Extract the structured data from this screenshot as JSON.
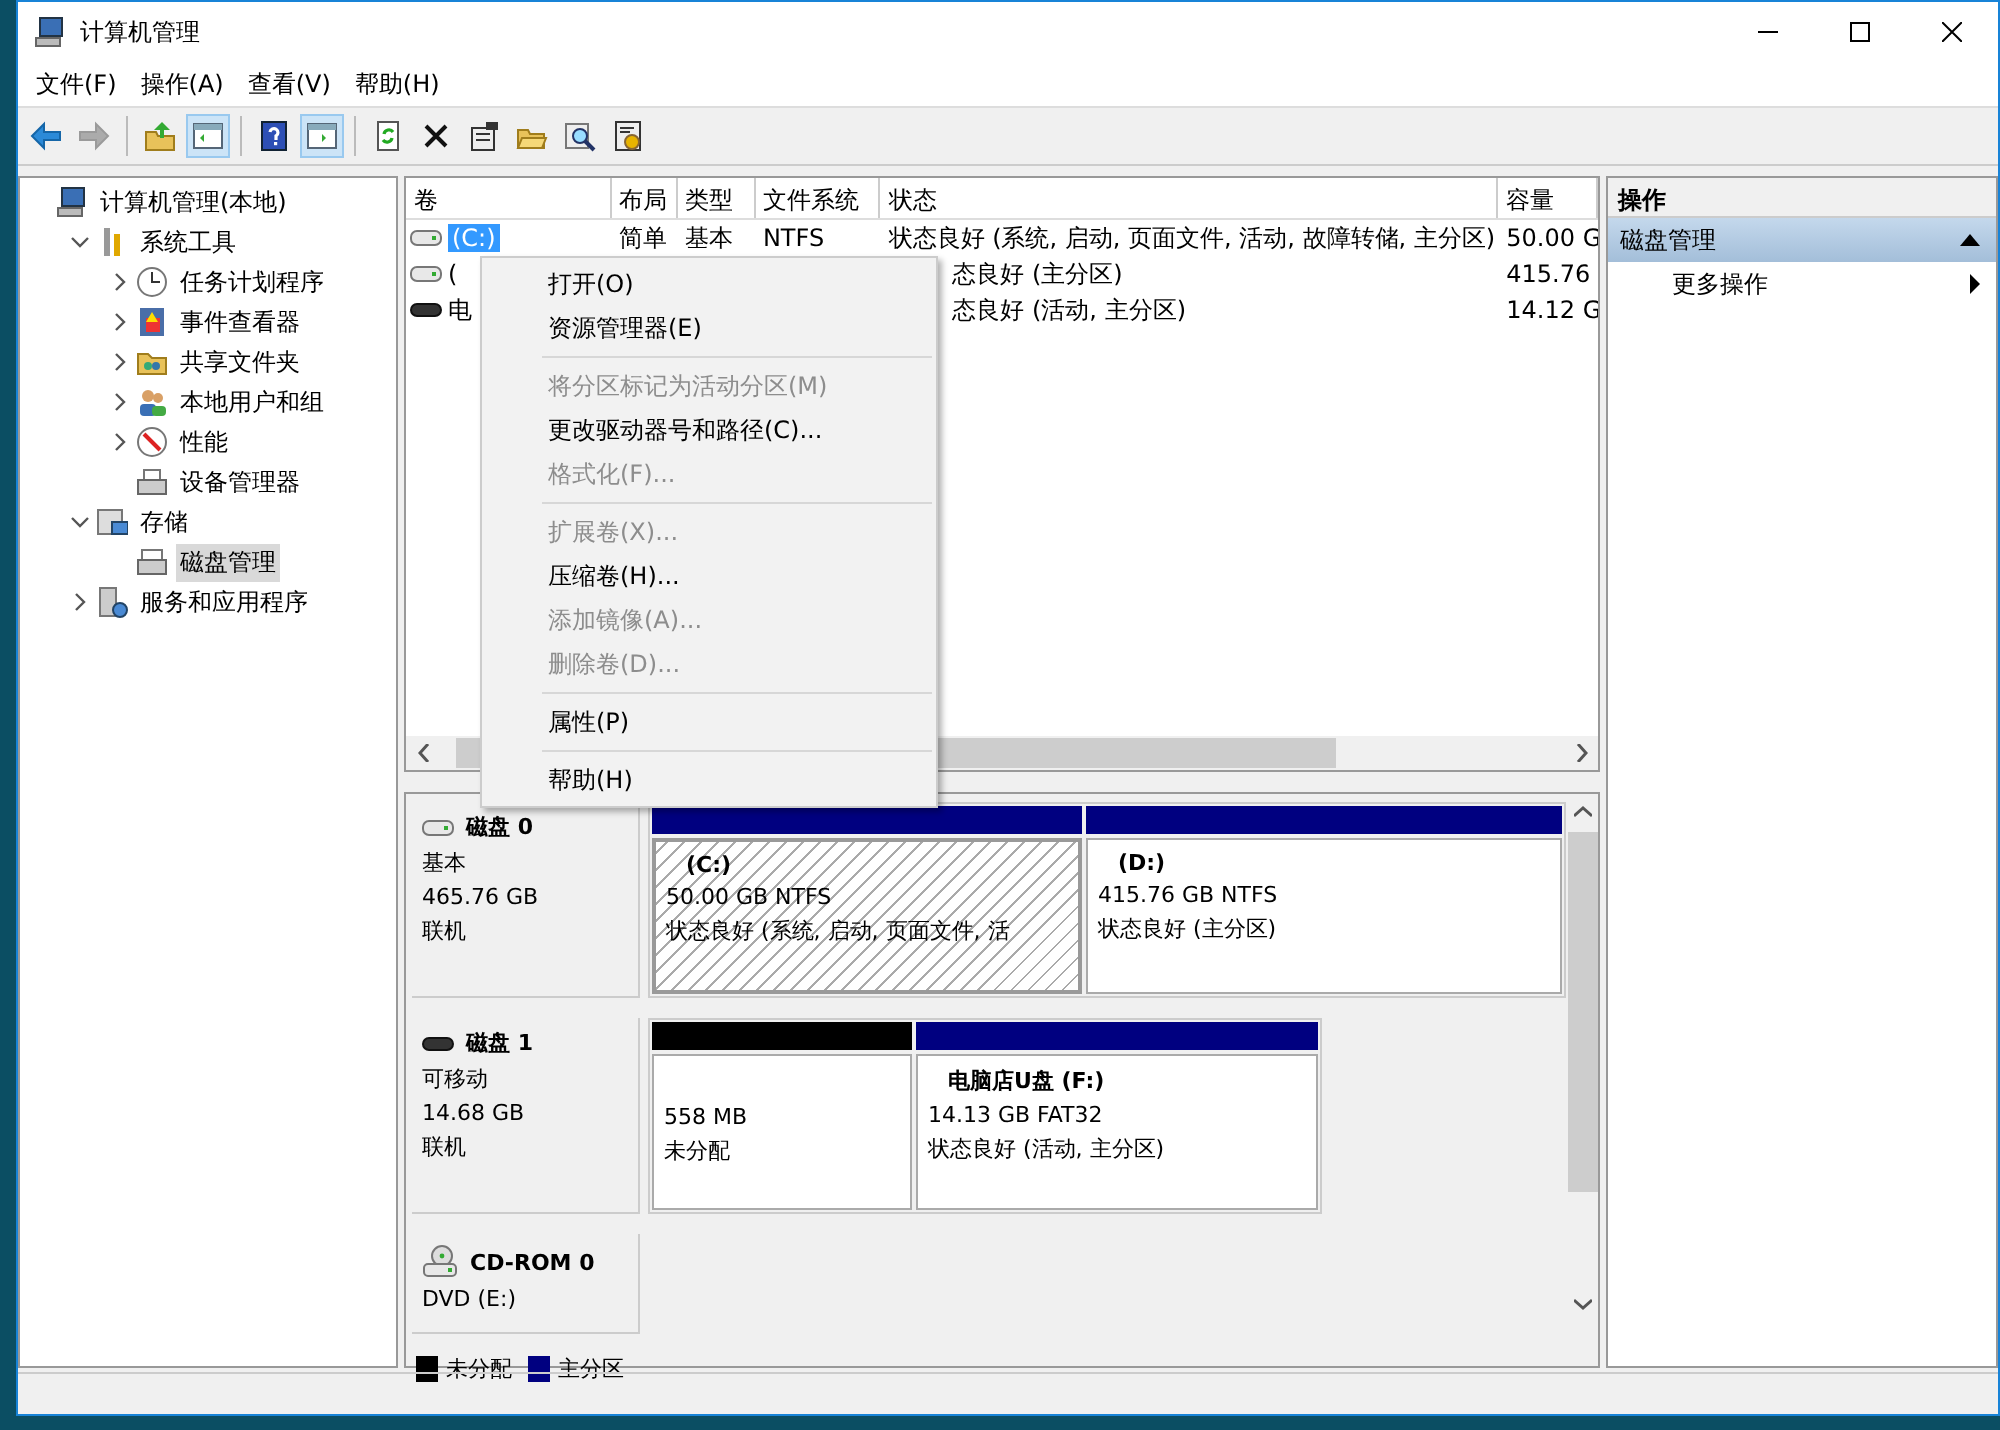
{
  "window": {
    "title": "计算机管理"
  },
  "menu_bar": [
    "文件(F)",
    "操作(A)",
    "查看(V)",
    "帮助(H)"
  ],
  "toolbar": [
    {
      "kind": "back",
      "disabled": false,
      "pressed": false
    },
    {
      "kind": "forward",
      "disabled": true,
      "pressed": false
    },
    {
      "kind": "sep"
    },
    {
      "kind": "up",
      "disabled": false,
      "pressed": false
    },
    {
      "kind": "tree",
      "disabled": false,
      "pressed": true
    },
    {
      "kind": "sep"
    },
    {
      "kind": "help",
      "disabled": false,
      "pressed": false
    },
    {
      "kind": "pane",
      "disabled": false,
      "pressed": true
    },
    {
      "kind": "sep"
    },
    {
      "kind": "refresh",
      "disabled": false,
      "pressed": false
    },
    {
      "kind": "delete",
      "disabled": false,
      "pressed": false
    },
    {
      "kind": "properties",
      "disabled": false,
      "pressed": false
    },
    {
      "kind": "open",
      "disabled": false,
      "pressed": false
    },
    {
      "kind": "search",
      "disabled": false,
      "pressed": false
    },
    {
      "kind": "settings",
      "disabled": false,
      "pressed": false
    }
  ],
  "tree": [
    {
      "label": "计算机管理(本地)",
      "selected": false,
      "children": [
        {
          "label": "系统工具",
          "expanded": true,
          "selected": false,
          "children": [
            {
              "label": "任务计划程序",
              "expanded": false,
              "selected": false
            },
            {
              "label": "事件查看器",
              "expanded": false,
              "selected": false
            },
            {
              "label": "共享文件夹",
              "expanded": false,
              "selected": false
            },
            {
              "label": "本地用户和组",
              "expanded": false,
              "selected": false
            },
            {
              "label": "性能",
              "expanded": false,
              "selected": false
            },
            {
              "label": "设备管理器",
              "selected": false
            }
          ]
        },
        {
          "label": "存储",
          "expanded": true,
          "selected": false,
          "children": [
            {
              "label": "磁盘管理",
              "selected": true
            }
          ]
        },
        {
          "label": "服务和应用程序",
          "expanded": false,
          "selected": false
        }
      ]
    }
  ],
  "volume_table": {
    "columns": [
      "卷",
      "布局",
      "类型",
      "文件系统",
      "状态",
      "容量"
    ],
    "rows": [
      {
        "selected": true,
        "cells": [
          "(C:)",
          "简单",
          "基本",
          "NTFS",
          "状态良好 (系统, 启动, 页面文件, 活动, 故障转储, 主分区)",
          "50.00 G"
        ]
      },
      {
        "selected": false,
        "cells": [
          "(",
          "",
          "",
          "",
          "态良好 (主分区)",
          "415.76"
        ]
      },
      {
        "selected": false,
        "cells": [
          "电",
          "",
          "",
          "",
          "态良好 (活动, 主分区)",
          "14.12 G"
        ]
      }
    ]
  },
  "context_menu": [
    {
      "kind": "item",
      "label": "打开(O)",
      "disabled": false
    },
    {
      "kind": "item",
      "label": "资源管理器(E)",
      "disabled": false
    },
    {
      "kind": "separator"
    },
    {
      "kind": "item",
      "label": "将分区标记为活动分区(M)",
      "disabled": true
    },
    {
      "kind": "item",
      "label": "更改驱动器号和路径(C)...",
      "disabled": false
    },
    {
      "kind": "item",
      "label": "格式化(F)...",
      "disabled": true
    },
    {
      "kind": "separator"
    },
    {
      "kind": "item",
      "label": "扩展卷(X)...",
      "disabled": true
    },
    {
      "kind": "item",
      "label": "压缩卷(H)...",
      "disabled": false
    },
    {
      "kind": "item",
      "label": "添加镜像(A)...",
      "disabled": true
    },
    {
      "kind": "item",
      "label": "删除卷(D)...",
      "disabled": true
    },
    {
      "kind": "separator"
    },
    {
      "kind": "item",
      "label": "属性(P)",
      "disabled": false
    },
    {
      "kind": "separator"
    },
    {
      "kind": "item",
      "label": "帮助(H)",
      "disabled": false
    }
  ],
  "disks": [
    {
      "name": "磁盘 0",
      "lines": [
        "基本",
        "465.76 GB",
        "联机"
      ],
      "partitions": [
        {
          "kind": "primary",
          "selected": true,
          "title": "(C:)",
          "lines": [
            "50.00 GB NTFS",
            "状态良好 (系统, 启动, 页面文件, 活"
          ]
        },
        {
          "kind": "primary",
          "selected": false,
          "title": "(D:)",
          "lines": [
            "415.76 GB NTFS",
            "状态良好 (主分区)"
          ]
        }
      ]
    },
    {
      "name": "磁盘 1",
      "lines": [
        "可移动",
        "14.68 GB",
        "联机"
      ],
      "partitions": [
        {
          "kind": "unallocated",
          "selected": false,
          "lines": [
            "558 MB",
            "未分配"
          ]
        },
        {
          "kind": "primary",
          "selected": false,
          "title": "电脑店U盘  (F:)",
          "lines": [
            "14.13 GB FAT32",
            "状态良好 (活动, 主分区)"
          ]
        }
      ]
    },
    {
      "name": "CD-ROM 0",
      "lines": [
        "DVD (E:)"
      ]
    }
  ],
  "legend": [
    {
      "label": "未分配",
      "color": "#000000"
    },
    {
      "label": "主分区",
      "color": "#000080"
    }
  ],
  "actions": {
    "title": "操作",
    "sections": [
      {
        "title": "磁盘管理",
        "expanded": true,
        "items": [
          "更多操作"
        ]
      }
    ]
  }
}
